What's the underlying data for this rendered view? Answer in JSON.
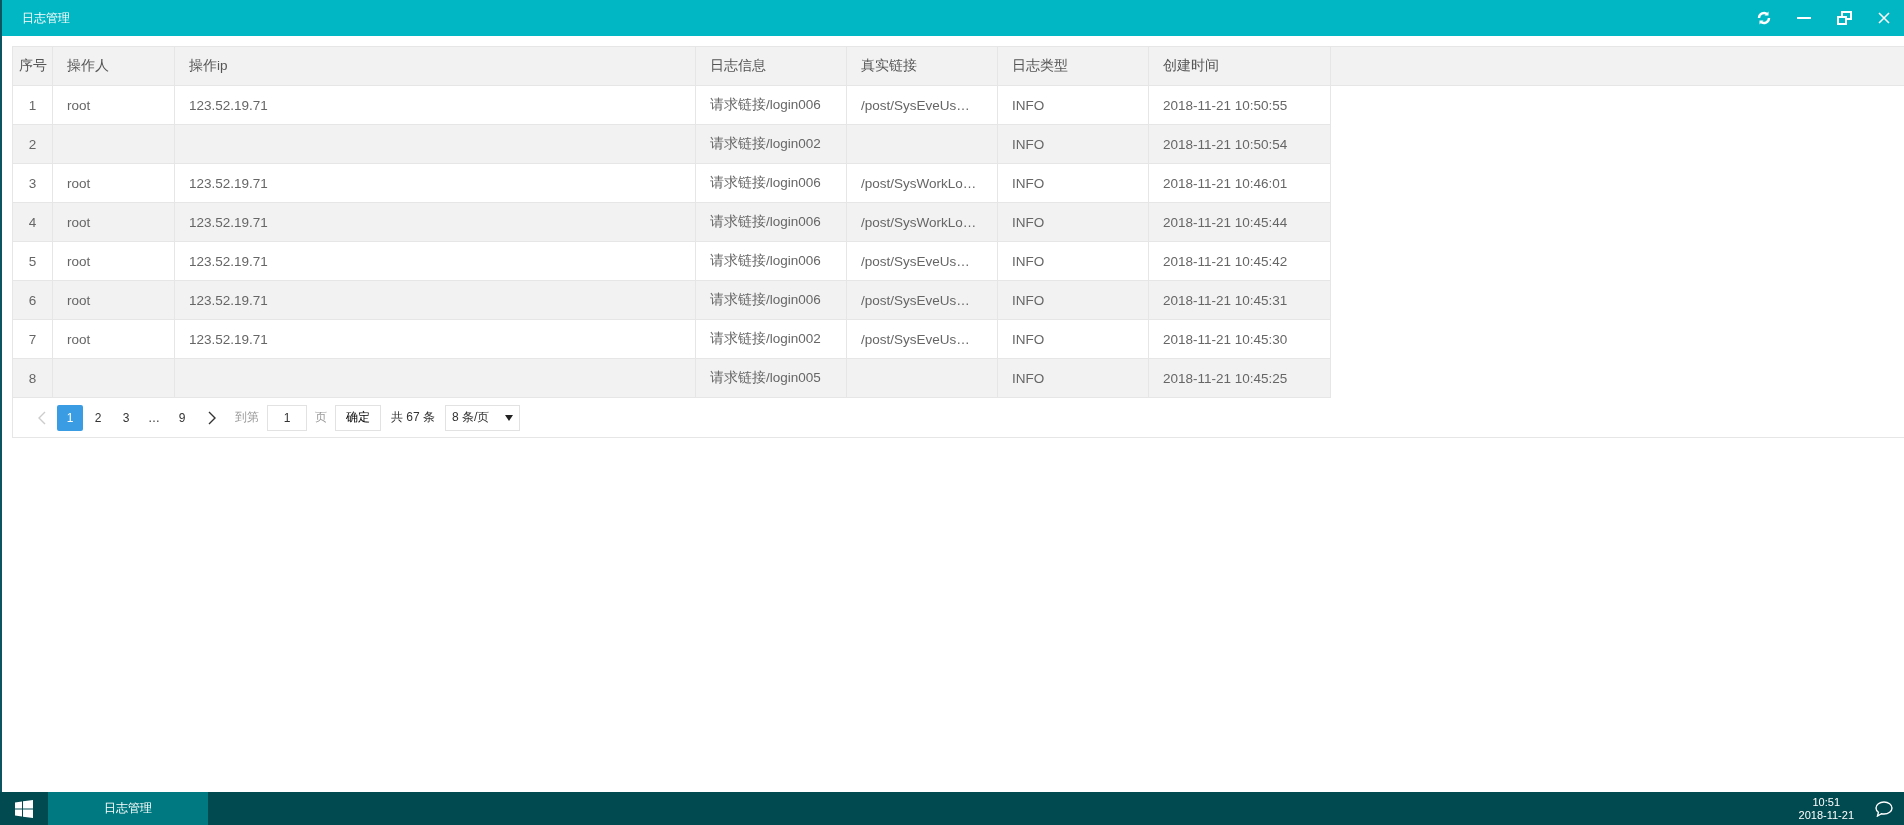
{
  "window": {
    "title": "日志管理"
  },
  "table": {
    "columns": [
      "序号",
      "操作人",
      "操作ip",
      "日志信息",
      "真实链接",
      "日志类型",
      "创建时间"
    ],
    "rows": [
      {
        "cells": [
          "1",
          "root",
          "123.52.19.71",
          "请求链接/login006",
          "/post/SysEveUs…",
          "INFO",
          "2018-11-21 10:50:55"
        ]
      },
      {
        "cells": [
          "2",
          "",
          "",
          "请求链接/login002",
          "",
          "INFO",
          "2018-11-21 10:50:54"
        ]
      },
      {
        "cells": [
          "3",
          "root",
          "123.52.19.71",
          "请求链接/login006",
          "/post/SysWorkLo…",
          "INFO",
          "2018-11-21 10:46:01"
        ]
      },
      {
        "cells": [
          "4",
          "root",
          "123.52.19.71",
          "请求链接/login006",
          "/post/SysWorkLo…",
          "INFO",
          "2018-11-21 10:45:44"
        ]
      },
      {
        "cells": [
          "5",
          "root",
          "123.52.19.71",
          "请求链接/login006",
          "/post/SysEveUs…",
          "INFO",
          "2018-11-21 10:45:42"
        ]
      },
      {
        "cells": [
          "6",
          "root",
          "123.52.19.71",
          "请求链接/login006",
          "/post/SysEveUs…",
          "INFO",
          "2018-11-21 10:45:31"
        ]
      },
      {
        "cells": [
          "7",
          "root",
          "123.52.19.71",
          "请求链接/login002",
          "/post/SysEveUs…",
          "INFO",
          "2018-11-21 10:45:30"
        ]
      },
      {
        "cells": [
          "8",
          "",
          "",
          "请求链接/login005",
          "",
          "INFO",
          "2018-11-21 10:45:25"
        ]
      }
    ]
  },
  "pagination": {
    "prev_disabled": true,
    "pages": [
      {
        "label": "1",
        "selected": true
      },
      {
        "label": "2",
        "selected": false
      },
      {
        "label": "3",
        "selected": false
      },
      {
        "label": "…",
        "selected": false
      },
      {
        "label": "9",
        "selected": false
      }
    ],
    "goto_label": "到第",
    "goto_value": "1",
    "page_unit": "页",
    "confirm": "确定",
    "total": "共 67 条",
    "page_size": "8 条/页"
  },
  "taskbar": {
    "items": [
      {
        "label": "日志管理",
        "selected": true
      }
    ],
    "time": "10:51",
    "date": "2018-11-21"
  }
}
